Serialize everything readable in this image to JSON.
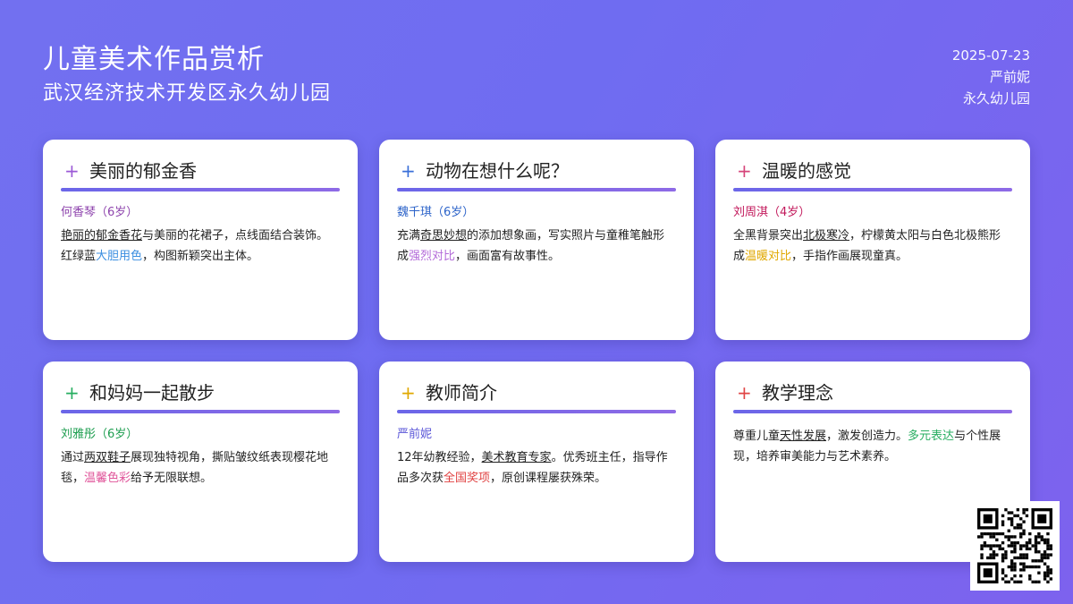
{
  "header": {
    "title": "儿童美术作品赏析",
    "subtitle": "武汉经济技术开发区永久幼儿园",
    "date": "2025-07-23",
    "author": "严前妮",
    "school": "永久幼儿园"
  },
  "cards": [
    {
      "title": "美丽的郁金香",
      "plus_color": "#9b59d6",
      "person": "何香琴（6岁）",
      "person_color": "#8e44ad",
      "desc": [
        {
          "t": "艳丽的郁金香花",
          "s": "u"
        },
        {
          "t": "与美丽的花裙子，点线面结合装饰。红绿蓝"
        },
        {
          "t": "大胆用色",
          "c": "#3a8ee0"
        },
        {
          "t": "，构图新颖突出主体。"
        }
      ]
    },
    {
      "title": "动物在想什么呢？",
      "plus_color": "#3a6fd8",
      "person": "魏千琪（6岁）",
      "person_color": "#2c63c9",
      "desc": [
        {
          "t": "充满"
        },
        {
          "t": "奇思妙想",
          "s": "u"
        },
        {
          "t": "的添加想象画，写实照片与童稚笔触形成"
        },
        {
          "t": "强烈对比",
          "c": "#b36bd9"
        },
        {
          "t": "，画面富有故事性。"
        }
      ]
    },
    {
      "title": "温暖的感觉",
      "plus_color": "#d6457a",
      "person": "刘周淇（4岁）",
      "person_color": "#c2185b",
      "desc": [
        {
          "t": "全黑背景突出"
        },
        {
          "t": "北极寒冷",
          "s": "u"
        },
        {
          "t": "，柠檬黄太阳与白色北极熊形成"
        },
        {
          "t": "温暖对比",
          "c": "#e0a800"
        },
        {
          "t": "，手指作画展现童真。"
        }
      ]
    },
    {
      "title": "和妈妈一起散步",
      "plus_color": "#27ae60",
      "person": "刘雅彤（6岁）",
      "person_color": "#1e9e50",
      "desc": [
        {
          "t": "通过"
        },
        {
          "t": "两双鞋子",
          "s": "u"
        },
        {
          "t": "展现独特视角，撕贴皱纹纸表现樱花地毯，"
        },
        {
          "t": "温馨色彩",
          "c": "#e0559a"
        },
        {
          "t": "给予无限联想。"
        }
      ]
    },
    {
      "title": "教师简介",
      "plus_color": "#e0a800",
      "person": "严前妮",
      "person_color": "#5a56d8",
      "desc": [
        {
          "t": "12年幼教经验，"
        },
        {
          "t": "美术教育专家",
          "s": "u"
        },
        {
          "t": "。优秀班主任，指导作品多次获"
        },
        {
          "t": "全国奖项",
          "c": "#e04040"
        },
        {
          "t": "，原创课程屡获殊荣。"
        }
      ]
    },
    {
      "title": "教学理念",
      "plus_color": "#e04545",
      "person": "",
      "person_color": "#333333",
      "desc": [
        {
          "t": "尊重儿童"
        },
        {
          "t": "天性发展",
          "s": "u"
        },
        {
          "t": "，激发创造力。"
        },
        {
          "t": "多元表达",
          "c": "#27ae60"
        },
        {
          "t": "与个性展现，培养审美能力与艺术素养。"
        }
      ]
    }
  ]
}
